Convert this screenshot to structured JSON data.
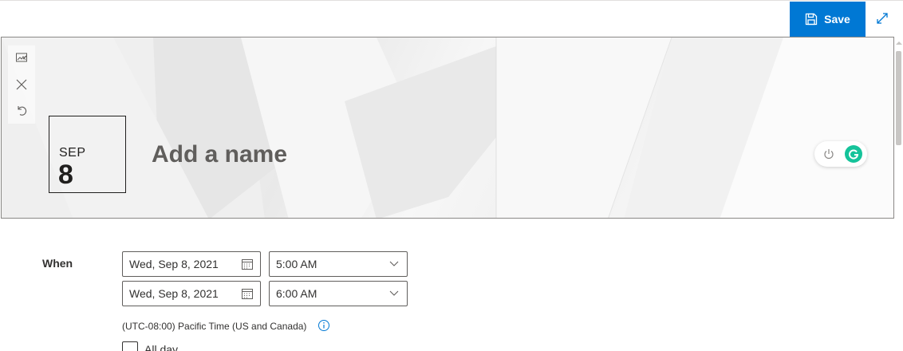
{
  "toolbar": {
    "save_label": "Save",
    "save_icon": "save-icon",
    "expand_icon": "expand-icon",
    "accent": "#0078d4"
  },
  "banner": {
    "tools": [
      "change-image-icon",
      "close-icon",
      "undo-icon"
    ],
    "date_month": "SEP",
    "date_day": "8",
    "name_placeholder": "Add a name"
  },
  "grammarly": {
    "power_icon": "power-icon",
    "logo": "grammarly-logo",
    "color": "#15c39a"
  },
  "when": {
    "label": "When",
    "start_date": "Wed, Sep 8, 2021",
    "start_time": "5:00 AM",
    "end_date": "Wed, Sep 8, 2021",
    "end_time": "6:00 AM",
    "timezone": "(UTC-08:00) Pacific Time (US and Canada)",
    "all_day_label": "All day"
  }
}
